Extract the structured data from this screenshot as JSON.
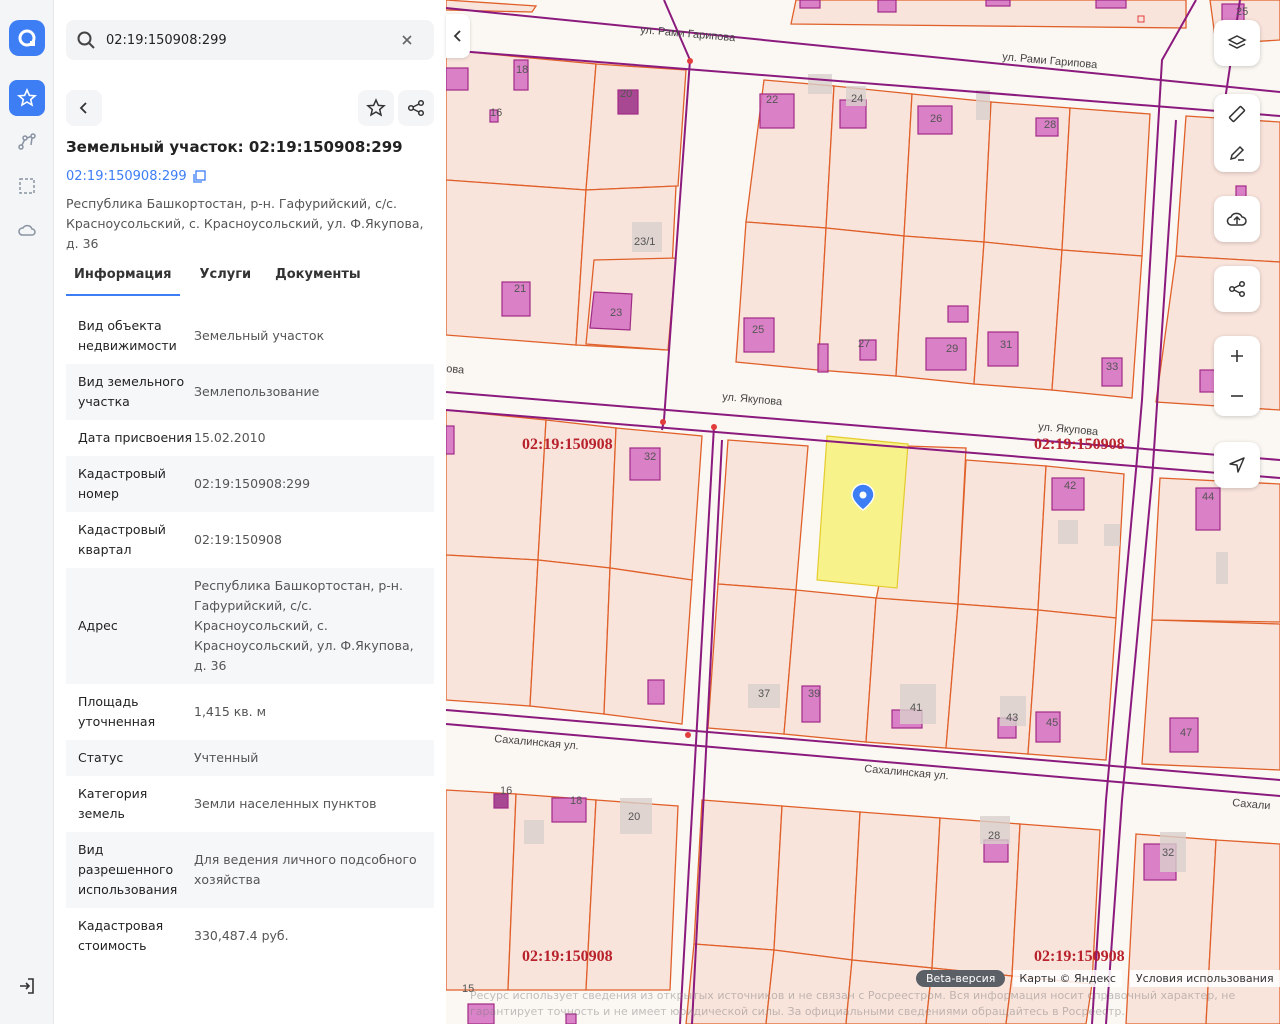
{
  "search": {
    "value": "02:19:150908:299"
  },
  "title": "Земельный участок: 02:19:150908:299",
  "cad_link": "02:19:150908:299",
  "address": "Республика Башкортостан, р-н. Гафурийский, с/с. Красноусольский, с. Красноусольский, ул. Ф.Якупова, д. 36",
  "tabs": [
    "Информация",
    "Услуги",
    "Документы"
  ],
  "rows": [
    {
      "k": "Вид объекта недвижимости",
      "v": "Земельный участок"
    },
    {
      "k": "Вид земельного участка",
      "v": "Землепользование"
    },
    {
      "k": "Дата присвоения",
      "v": "15.02.2010"
    },
    {
      "k": "Кадастровый номер",
      "v": "02:19:150908:299"
    },
    {
      "k": "Кадастровый квартал",
      "v": "02:19:150908"
    },
    {
      "k": "Адрес",
      "v": "Республика Башкортостан, р-н. Гафурийский, с/с. Красноусольский, с. Красноусольский, ул. Ф.Якупова, д. 36"
    },
    {
      "k": "Площадь уточненная",
      "v": "1,415 кв. м"
    },
    {
      "k": "Статус",
      "v": "Учтенный"
    },
    {
      "k": "Категория земель",
      "v": "Земли населенных пунктов"
    },
    {
      "k": "Вид разрешенного использования",
      "v": "Для ведения личного подсобного хозяйства"
    },
    {
      "k": "Кадастровая стоимость",
      "v": "330,487.4 руб."
    }
  ],
  "map": {
    "streets": [
      "ул. Рами Гарипова",
      "ул. Рами Гарипова",
      "ул. Якупова",
      "ул. Якупова",
      "ова",
      "Сахалинская ул.",
      "Сахалинская ул.",
      "Сахали"
    ],
    "quarters": [
      "02:19:150908",
      "02:19:150908",
      "02:19:150908",
      "02:19:150908"
    ],
    "house_numbers": [
      "25",
      "18",
      "20",
      "16",
      "22",
      "24",
      "26",
      "28",
      "23/1",
      "21",
      "23",
      "25",
      "27",
      "29",
      "31",
      "33",
      "32",
      "42",
      "44",
      "37",
      "39",
      "41",
      "43",
      "45",
      "47",
      "16",
      "18",
      "20",
      "28",
      "32",
      "15"
    ],
    "beta": "Beta-версия",
    "attribution": "Карты © Яндекс",
    "terms": "Условия использования",
    "notice": "Ресурс использует сведения из открытых источников и не связан с Росреестром. Вся информация носит справочный характер, не гарантирует точность и не имеет юридической силы. За официальными сведениями обращайтесь в Росреестр."
  }
}
